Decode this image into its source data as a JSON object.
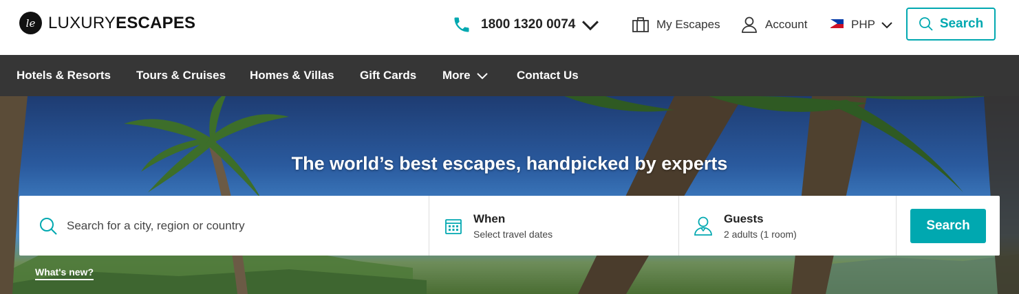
{
  "brand": {
    "logo_mark": "le",
    "name_light": "LUXURY",
    "name_bold": "ESCAPES"
  },
  "header": {
    "phone": "1800 1320 0074",
    "my_escapes": "My Escapes",
    "account": "Account",
    "currency": "PHP",
    "search": "Search"
  },
  "nav": {
    "items": [
      {
        "label": "Hotels & Resorts"
      },
      {
        "label": "Tours & Cruises"
      },
      {
        "label": "Homes & Villas"
      },
      {
        "label": "Gift Cards"
      },
      {
        "label": "More"
      },
      {
        "label": "Contact Us"
      }
    ]
  },
  "hero": {
    "headline": "The world’s best escapes, handpicked by experts",
    "whats_new": "What's new?"
  },
  "search": {
    "destination_placeholder": "Search for a city, region or country",
    "when_label": "When",
    "when_value": "Select travel dates",
    "guests_label": "Guests",
    "guests_value": "2 adults (1 room)",
    "button": "Search"
  },
  "colors": {
    "accent": "#00a8b0",
    "navbar": "#363636"
  }
}
